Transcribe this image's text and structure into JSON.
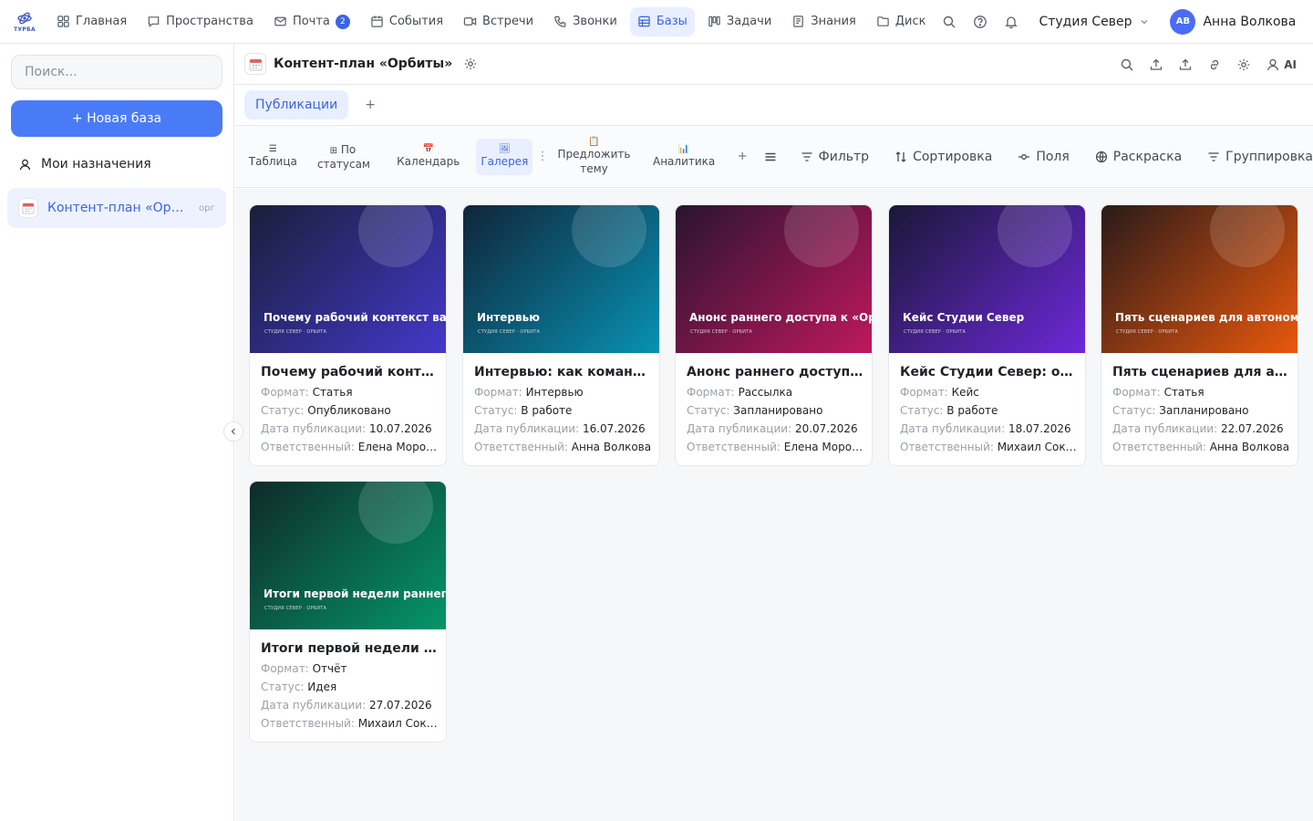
{
  "app": {
    "logo_text": "ТУРБА"
  },
  "topnav": {
    "items": [
      {
        "label": "Главная",
        "icon": "grid-icon"
      },
      {
        "label": "Пространства",
        "icon": "chat-icon"
      },
      {
        "label": "Почта",
        "icon": "mail-icon",
        "badge": "2"
      },
      {
        "label": "События",
        "icon": "calendar-icon"
      },
      {
        "label": "Встречи",
        "icon": "video-icon"
      },
      {
        "label": "Звонки",
        "icon": "phone-icon"
      },
      {
        "label": "Базы",
        "icon": "table-icon",
        "active": true
      },
      {
        "label": "Задачи",
        "icon": "kanban-icon"
      },
      {
        "label": "Знания",
        "icon": "book-icon"
      },
      {
        "label": "Диск",
        "icon": "folder-icon"
      }
    ],
    "workspace": "Студия Север",
    "user": {
      "initials": "АВ",
      "name": "Анна Волкова"
    }
  },
  "sidebar": {
    "search_placeholder": "Поиск...",
    "new_button": "+ Новая база",
    "my_assignments": "Мои назначения",
    "database": {
      "label": "Контент-план «Орбиты»",
      "tag": "орг"
    }
  },
  "header": {
    "title": "Контент-план «Орбиты»",
    "ai_label": "AI"
  },
  "tabs": {
    "items": [
      "Публикации"
    ],
    "add": "+"
  },
  "views": {
    "items": [
      {
        "icon": "☰",
        "label": "Таблица"
      },
      {
        "icon": "⊞",
        "label": "По статусам"
      },
      {
        "icon": "📅",
        "label": "Календарь"
      },
      {
        "icon": "🖼",
        "label": "Галерея",
        "active": true
      },
      {
        "icon": "📋",
        "label": "Предложить тему"
      },
      {
        "icon": "📊",
        "label": "Аналитика"
      }
    ],
    "more": "⋮",
    "add": "+",
    "tools": {
      "filter": "Фильтр",
      "sort": "Сортировка",
      "fields": "Поля",
      "coloring": "Раскраска",
      "group": "Группировка"
    }
  },
  "field_labels": {
    "format": "Формат:",
    "status": "Статус:",
    "date": "Дата публикации:",
    "owner": "Ответственный:"
  },
  "cards": [
    {
      "cover_title": "Почему рабочий контекст важнее",
      "cover_sub": "СТУДИЯ СЕВЕР · ОРБИТА",
      "title": "Почему рабочий контекст важнее",
      "format": "Статья",
      "status": "Опубликовано",
      "date": "10.07.2026",
      "owner": "Елена Морозова",
      "colors": [
        "#1a1f3a",
        "#4338ca"
      ]
    },
    {
      "cover_title": "Интервью",
      "cover_sub": "СТУДИЯ СЕВЕР · ОРБИТА",
      "title": "Интервью: как команда з...",
      "format": "Интервью",
      "status": "В работе",
      "date": "16.07.2026",
      "owner": "Анна Волкова",
      "colors": [
        "#10253a",
        "#0891b2"
      ]
    },
    {
      "cover_title": "Анонс раннего доступа к «Орбите»",
      "cover_sub": "СТУДИЯ СЕВЕР · ОРБИТА",
      "title": "Анонс раннего доступа к «Орбите»",
      "format": "Рассылка",
      "status": "Запланировано",
      "date": "20.07.2026",
      "owner": "Елена Морозова",
      "colors": [
        "#2a1430",
        "#be185d"
      ]
    },
    {
      "cover_title": "Кейс Студии Север",
      "cover_sub": "СТУДИЯ СЕВЕР · ОРБИТА",
      "title": "Кейс Студии Север: от идеи",
      "format": "Кейс",
      "status": "В работе",
      "date": "18.07.2026",
      "owner": "Михаил Соколов",
      "colors": [
        "#1a1838",
        "#6d28d9"
      ]
    },
    {
      "cover_title": "Пять сценариев для автономной",
      "cover_sub": "СТУДИЯ СЕВЕР · ОРБИТА",
      "title": "Пять сценариев для автономной",
      "format": "Статья",
      "status": "Запланировано",
      "date": "22.07.2026",
      "owner": "Анна Волкова",
      "colors": [
        "#2a1a1a",
        "#ea580c"
      ]
    },
    {
      "cover_title": "Итоги первой недели раннего доступа",
      "cover_sub": "СТУДИЯ СЕВЕР · ОРБИТА",
      "title": "Итоги первой недели раннего доступа",
      "format": "Отчёт",
      "status": "Идея",
      "date": "27.07.2026",
      "owner": "Михаил Соколов",
      "colors": [
        "#0f2a2a",
        "#059669"
      ]
    }
  ]
}
